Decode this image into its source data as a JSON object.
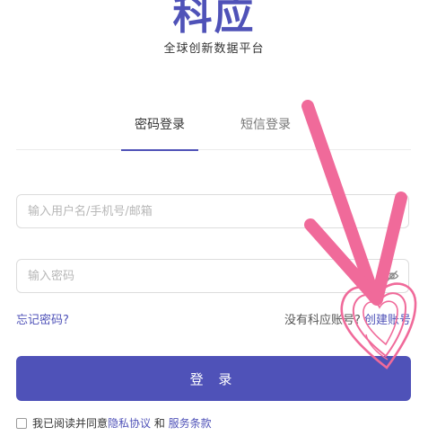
{
  "brand": {
    "logo_text": "科应",
    "tagline": "全球创新数据平台"
  },
  "tabs": [
    {
      "label": "密码登录",
      "active": true
    },
    {
      "label": "短信登录",
      "active": false
    }
  ],
  "form": {
    "username_placeholder": "输入用户名/手机号/邮箱",
    "password_placeholder": "输入密码"
  },
  "links": {
    "forgot_password": "忘记密码?",
    "no_account": "没有科应账号?",
    "create_account": "创建账号"
  },
  "login_button": "登 录",
  "agreement": {
    "prefix": "我已阅读并同意",
    "privacy": "隐私协议",
    "and": " 和 ",
    "terms": "服务条款"
  },
  "colors": {
    "accent": "#4f52b8",
    "annotation": "#f06a9a"
  },
  "icons": {
    "password_toggle": "eye-off-icon",
    "annotation_arrow": "arrow-icon",
    "annotation_heart": "heart-icon"
  }
}
